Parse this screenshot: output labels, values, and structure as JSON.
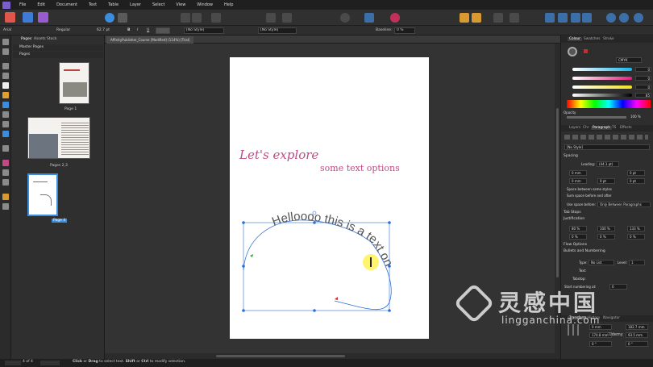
{
  "menubar": {
    "items": [
      "File",
      "Edit",
      "Document",
      "Text",
      "Table",
      "Layer",
      "Select",
      "View",
      "Window",
      "Help"
    ]
  },
  "context": {
    "font_family": "Arial",
    "font_style": "Regular",
    "font_size": "62.7 pt",
    "bold": "B",
    "italic": "I",
    "underline": "U",
    "char_style": "[No Style]",
    "para_style": "[No Style]",
    "baseline_label": "Baseline:",
    "baseline_value": "0 %"
  },
  "pages_panel": {
    "tabs": [
      "Pages",
      "Assets",
      "Stock"
    ],
    "master_label": "Master Pages",
    "pages_label": "Pages",
    "page1": "Page 1",
    "pages23": "Pages 2,3",
    "page4": "Page 4"
  },
  "document": {
    "tab_title": "AffinityPublisher_Course [Modified] (114%) [Trial]",
    "headline": "Let's explore",
    "subhead": "some text options",
    "path_text": "Helloooo this is a text on"
  },
  "color_panel": {
    "tabs": [
      "Colour",
      "Swatches",
      "Stroke"
    ],
    "model": "CMYK",
    "c": "0",
    "m": "0",
    "y": "0",
    "k": "85",
    "opacity_label": "Opacity",
    "opacity_value": "100 %"
  },
  "paragraph_panel": {
    "tabs": [
      "Layers",
      "Chr",
      "Paragraph",
      "TS",
      "Effects"
    ],
    "style": "[No Style]",
    "spacing": "Spacing",
    "leading_label": "Leading:",
    "leading_value": "(44.1 pt)",
    "space_before": "0 mm",
    "space_after": "0 mm",
    "indent1": "0 pt",
    "indent2": "0 pt",
    "indent3": "0 pt",
    "space_same": "Space between same styles",
    "sum_space": "Sum space before and after",
    "use_space_label": "Use space before:",
    "use_space_value": "Only Between Paragraphs",
    "tab_stops": "Tab Stops",
    "justification": "Justification",
    "j1": "80 %",
    "j2": "100 %",
    "j3": "133 %",
    "j4": "0 %",
    "j5": "0 %",
    "j6": "0 %",
    "flow": "Flow Options",
    "bullets": "Bullets and Numbering",
    "type_label": "Type:",
    "type_value": "No List",
    "level_label": "Level:",
    "level_value": "1",
    "text_label": "Text:",
    "tabstop_label": "Tabstop:",
    "start_label": "Start numbering at:",
    "start_value": "0"
  },
  "transform": {
    "tabs": [
      "Transform",
      "History",
      "Navigator"
    ],
    "x": "0 mm",
    "y": "0 mm",
    "w": "174.8 mm",
    "h": "93.5 mm",
    "r": "0 °",
    "s": "0 °",
    "w2": "182.7 mm"
  },
  "statusbar": {
    "page": "4 of 4",
    "hint_click": "Click",
    "hint_or": " or ",
    "hint_drag": "Drag",
    "hint_rest": " to select text. ",
    "hint_shift": "Shift",
    "hint_or2": " or ",
    "hint_ctrl": "Ctrl",
    "hint_end": " to modify selection."
  },
  "watermark": {
    "cn": "灵感中国",
    "url": "lingganchina.com",
    "udemy": "Udemy"
  },
  "colors": {
    "accent": "#3c8de0",
    "headline": "#c04a86",
    "path_text": "#555555",
    "selection": "#2e6fd6"
  }
}
